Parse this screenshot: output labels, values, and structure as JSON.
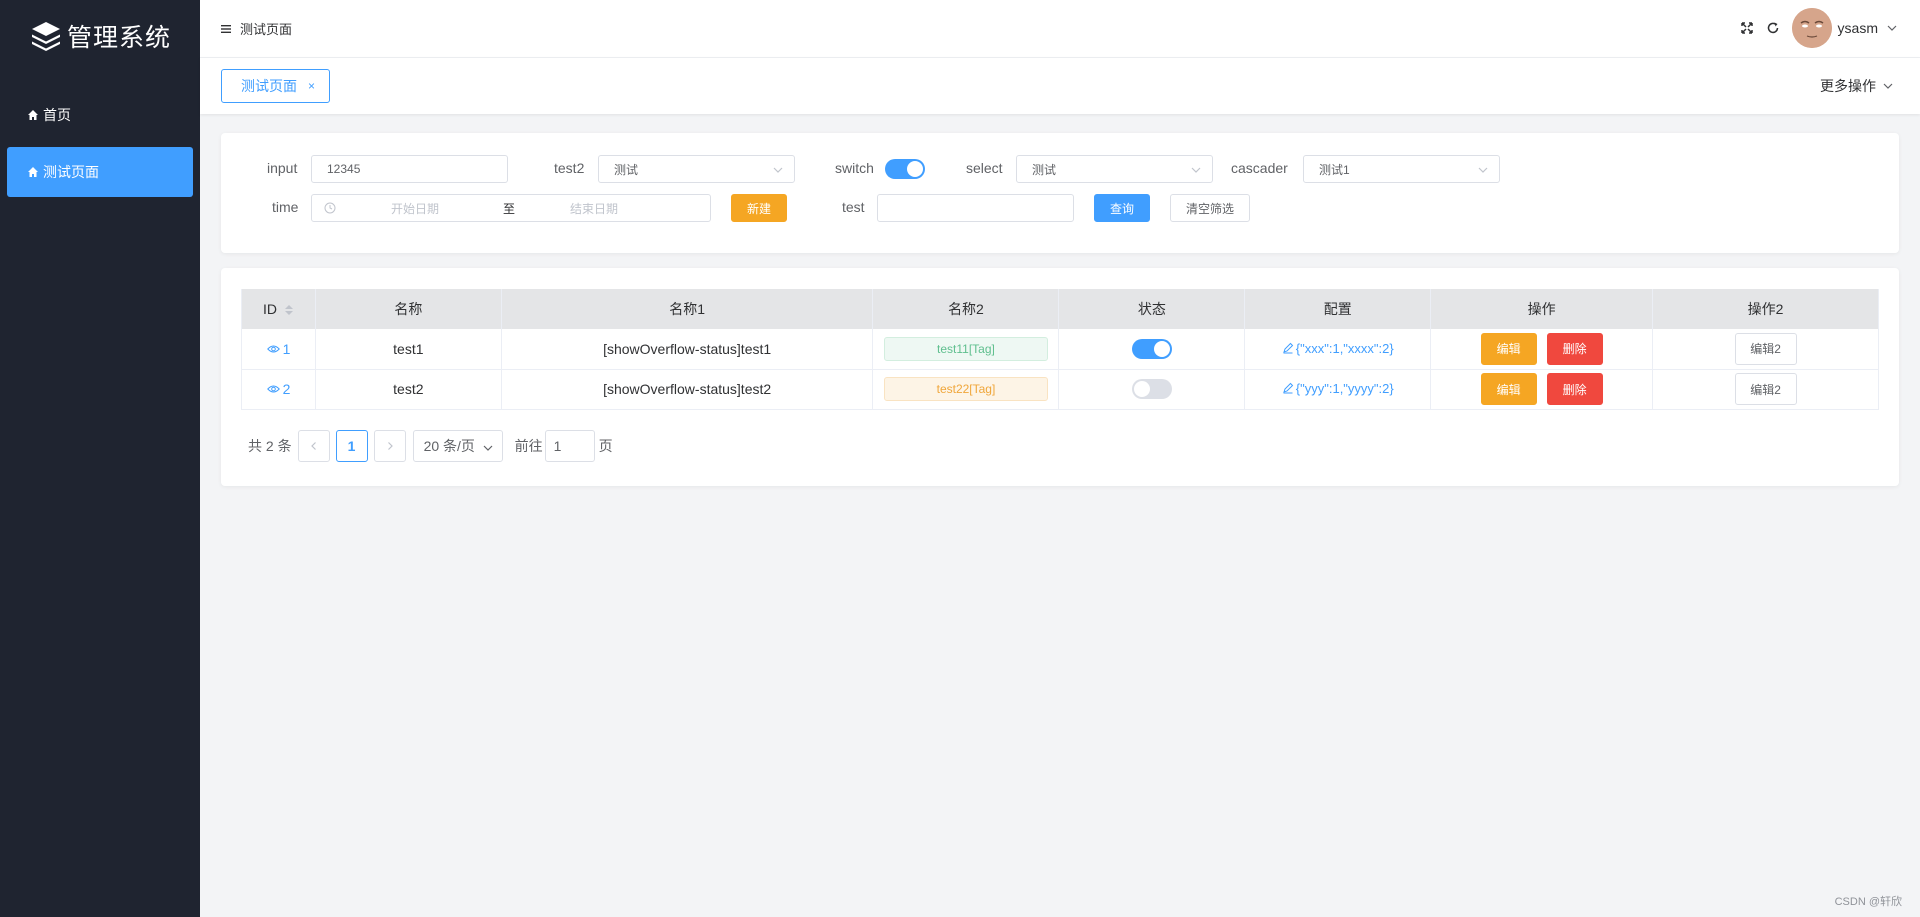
{
  "app": {
    "title": "管理系统"
  },
  "sidebar": {
    "items": [
      {
        "label": "首页",
        "active": false
      },
      {
        "label": "测试页面",
        "active": true
      }
    ]
  },
  "header": {
    "breadcrumb": "测试页面",
    "username": "ysasm"
  },
  "tabs": {
    "items": [
      {
        "label": "测试页面",
        "close": "×"
      }
    ],
    "more_ops": "更多操作"
  },
  "filters": {
    "input_label": "input",
    "input_value": "12345",
    "test2_label": "test2",
    "test2_value": "测试",
    "switch_label": "switch",
    "switch_on": true,
    "select_label": "select",
    "select_value": "测试",
    "cascader_label": "cascader",
    "cascader_value": "测试1",
    "time_label": "time",
    "time_start_placeholder": "开始日期",
    "time_sep": "至",
    "time_end_placeholder": "结束日期",
    "new_button": "新建",
    "test_label": "test",
    "test_value": "",
    "query_button": "查询",
    "clear_button": "清空筛选"
  },
  "table": {
    "columns": [
      "ID",
      "名称",
      "名称1",
      "名称2",
      "状态",
      "配置",
      "操作",
      "操作2"
    ],
    "rows": [
      {
        "id": "1",
        "name": "test1",
        "name1": "[showOverflow-status]test1",
        "name2": "test11[Tag]",
        "tag_type": "success",
        "status_on": true,
        "config": "{\"xxx\":1,\"xxxx\":2}",
        "edit": "编辑",
        "delete": "删除",
        "edit2": "编辑2"
      },
      {
        "id": "2",
        "name": "test2",
        "name1": "[showOverflow-status]test2",
        "name2": "test22[Tag]",
        "tag_type": "warning",
        "status_on": false,
        "config": "{\"yyy\":1,\"yyyy\":2}",
        "edit": "编辑",
        "delete": "删除",
        "edit2": "编辑2"
      }
    ]
  },
  "pagination": {
    "total_text": "共 2 条",
    "current_page": "1",
    "page_size": "20 条/页",
    "goto_label": "前往",
    "goto_value": "1",
    "goto_unit": "页"
  },
  "watermark": "CSDN @轩欣",
  "colors": {
    "primary": "#409eff",
    "warning": "#f5a623",
    "danger": "#f0483e",
    "sidebar": "#1f2430"
  }
}
